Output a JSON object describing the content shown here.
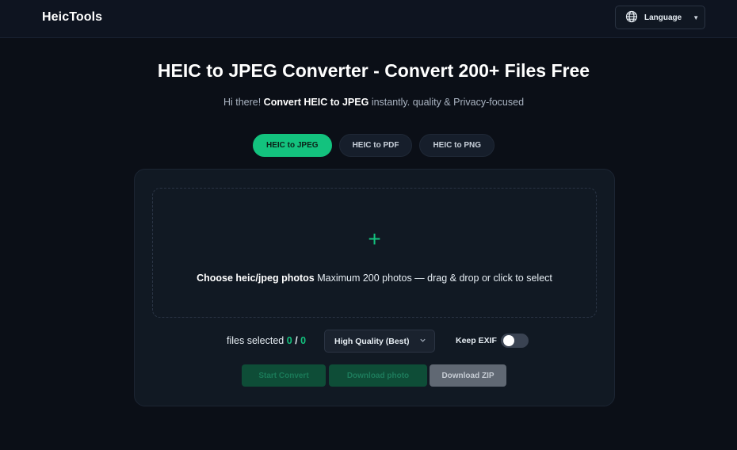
{
  "header": {
    "logo": "HeicTools",
    "language_label": "Language",
    "language_icon": "globe-icon",
    "caret_icon": "caret-down-icon"
  },
  "hero": {
    "title": "HEIC to JPEG Converter - Convert 200+ Files Free",
    "subtitle_prefix": "Hi there! ",
    "subtitle_bold": "Convert HEIC to JPEG",
    "subtitle_suffix": " instantly. quality & Privacy-focused"
  },
  "tabs": [
    {
      "label": "HEIC to JPEG",
      "active": true
    },
    {
      "label": "HEIC to PDF",
      "active": false
    },
    {
      "label": "HEIC to PNG",
      "active": false
    }
  ],
  "dropzone": {
    "icon": "plus-icon",
    "plus_glyph": "+",
    "bold_text": "Choose heic/jpeg photos",
    "text": " Maximum 200 photos — drag & drop or click to select"
  },
  "controls": {
    "files_selected_label": "files selected",
    "selected_count": "0",
    "separator": "/",
    "total_count": "0",
    "quality_selected": "High Quality (Best)",
    "keep_exif_label": "Keep EXIF",
    "keep_exif_on": false
  },
  "actions": {
    "start_convert": "Start Convert",
    "download_photo": "Download photo",
    "download_zip": "Download ZIP"
  },
  "colors": {
    "accent": "#13c27e",
    "background": "#0b0f17",
    "card": "#111923"
  }
}
